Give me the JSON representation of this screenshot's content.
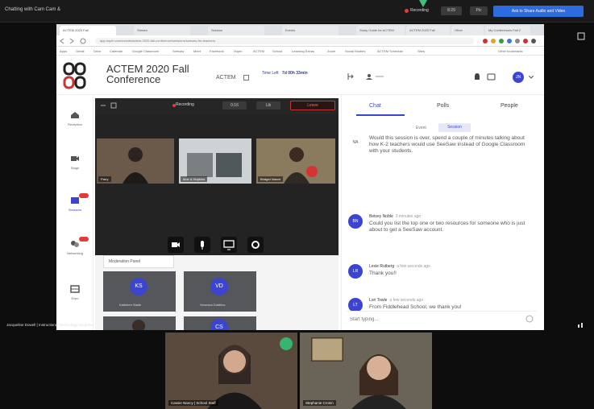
{
  "zoom": {
    "title": "Chatting with Cam Cam &",
    "recording_label": "Recording",
    "btn1": "8:29",
    "btn2": "Pic",
    "primary": "Ask to Share Audio and Video"
  },
  "browser": {
    "tabs": [
      "ACTEM 2020 Fall",
      "Stream",
      "Session",
      "Events",
      "Study Guide for ACTEM",
      "ACTEM 2020 Fall",
      "Other",
      "My Conferences Fall 2"
    ],
    "url": "app.hopin.com/events/actem-2020-fall-conference/sessions/seesaw-for-teachers",
    "bookmarks": [
      "Apps",
      "Gmail",
      "Drive",
      "Calendar",
      "Google Classroom",
      "Seesaw",
      "Meet",
      "Facebook",
      "Hopin",
      "ACTEM",
      "School",
      "Learning Extras",
      "Zoom",
      "Social Studies",
      "ACTEM Schedule",
      "Sites",
      "Other bookmarks"
    ]
  },
  "app": {
    "title": "ACTEM 2020 Fall Conference",
    "org": "ACTEM",
    "time_left_label": "Time Left",
    "time_left_value": "7d 00h 33min",
    "user_initials": "JN"
  },
  "nav": [
    {
      "label": "Reception",
      "icon": "home-icon"
    },
    {
      "label": "Stage",
      "icon": "video-icon"
    },
    {
      "label": "Sessions",
      "icon": "sessions-icon"
    },
    {
      "label": "Networking",
      "icon": "networking-icon"
    },
    {
      "label": "Expo",
      "icon": "expo-icon"
    }
  ],
  "stage": {
    "recording": "Recording",
    "pill1": "0:16",
    "pill2": "Lib",
    "leave": "Leave",
    "tiles": [
      {
        "name": "Parry"
      },
      {
        "name": "Moe & Hopkins"
      },
      {
        "name": "Bridget Nance"
      }
    ]
  },
  "moderation": {
    "tab": "Moderation Panel",
    "tiles": [
      {
        "initials": "KS",
        "name": "Kathleen Slade"
      },
      {
        "initials": "VD",
        "name": "Veronica Dobbins"
      },
      {
        "initials": "",
        "name": ""
      },
      {
        "initials": "CS",
        "name": ""
      }
    ]
  },
  "chat": {
    "tabs": [
      "Chat",
      "Polls",
      "People"
    ],
    "sub_event": "Event",
    "sub_session": "Session",
    "messages": [
      {
        "initials": "NA",
        "who": "",
        "when": "",
        "text": "Would this session is over, spend a couple of minutes talking about how K-2 teachers would use SeeSaw instead of Google Classroom with your students."
      },
      {
        "initials": "BN",
        "who": "Betsey Noble",
        "when": "3 minutes ago",
        "text": "Could you list the top one or two resources for someone who is just about to get a SeeSaw account."
      },
      {
        "initials": "LR",
        "who": "Lexie Rutberg",
        "when": "a few seconds ago",
        "text": "Thank you!!"
      },
      {
        "initials": "LT",
        "who": "Lori Towle",
        "when": "a few seconds ago",
        "text": "From Fiddlehead School, we thank you!"
      }
    ],
    "input_placeholder": "Start typing..."
  },
  "speakers": {
    "side_name": "Jacqueline Dowell | Instructional Technology Integrator",
    "tile1": "Cassie Nancy | School Staff",
    "tile2": "Stephanie Cronin"
  }
}
